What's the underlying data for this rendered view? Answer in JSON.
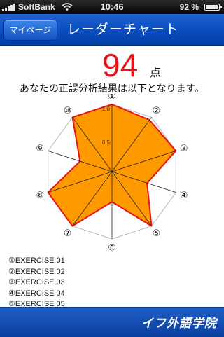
{
  "status_bar": {
    "carrier": "SoftBank",
    "time": "10:46",
    "battery": "92 %"
  },
  "nav": {
    "back_label": "マイページ",
    "title": "レーダーチャート"
  },
  "score": {
    "value": "94",
    "unit": "点",
    "caption": "あなたの正誤分析結果は以下となります。"
  },
  "chart_data": {
    "type": "radar",
    "axes": [
      "①",
      "②",
      "③",
      "④",
      "⑤",
      "⑥",
      "⑦",
      "⑧",
      "⑨",
      "⑩"
    ],
    "values": [
      1.0,
      0.95,
      1.0,
      0.55,
      1.0,
      0.45,
      1.0,
      1.0,
      0.5,
      1.0
    ],
    "range": [
      0,
      1
    ],
    "tick_labels": [
      "0.5",
      "1.0"
    ],
    "colors": {
      "fill": "#ff9900",
      "stroke": "#e8121b",
      "grid": "#b5b5b5"
    }
  },
  "exercises": [
    "①EXERCISE 01",
    "②EXERCISE 02",
    "③EXERCISE 03",
    "④EXERCISE 04",
    "⑤EXERCISE 05"
  ],
  "footer": {
    "logo": "イフ外語学院"
  },
  "colors": {
    "nav": "#0a4fc0",
    "score": "#e8121b"
  }
}
